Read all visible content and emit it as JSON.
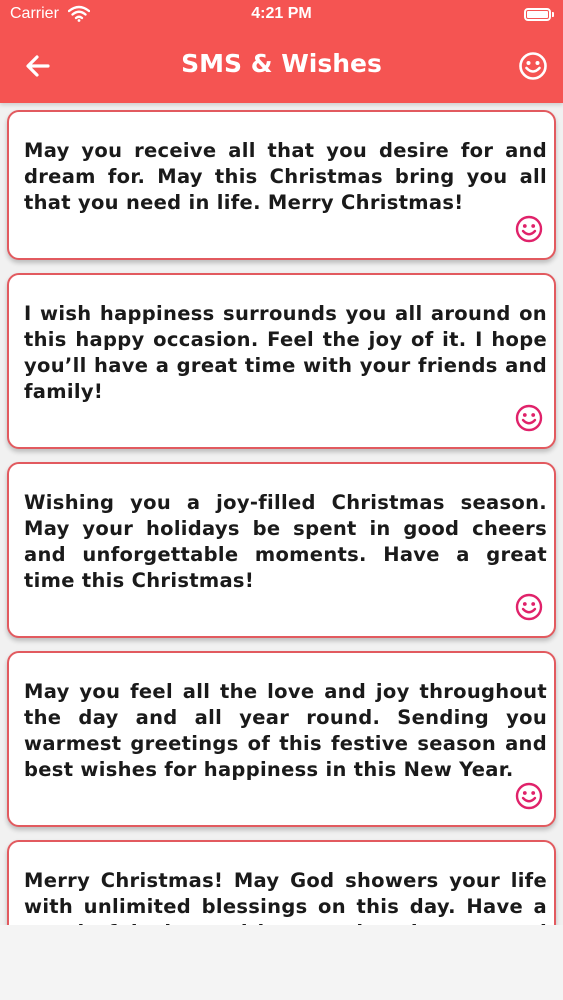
{
  "status_bar": {
    "carrier": "Carrier",
    "time": "4:21 PM"
  },
  "header": {
    "title": "SMS & Wishes",
    "back_icon": "arrow-left-icon",
    "right_icon": "smiley-icon"
  },
  "colors": {
    "header_bg": "#f55452",
    "card_border": "#e25a5f",
    "icon": "#e0226a"
  },
  "cards": [
    {
      "text": "May you receive all that you desire for and dream for. May this Christmas bring you all that you need in life. Merry Christmas!",
      "icon": "smiley-icon"
    },
    {
      "text": "I wish happiness surrounds you all around on this happy occasion. Feel the joy of it. I hope you’ll have a great time with your friends and family!",
      "icon": "smiley-icon"
    },
    {
      "text": "Wishing you a joy-filled Christmas season. May your holidays be spent in good cheers and unforgettable moments. Have a great time this Christmas!",
      "icon": "smiley-icon"
    },
    {
      "text": "May you feel all the love and joy throughout the day and all year round. Sending you warmest greetings of this festive season and best wishes for happiness in this New Year.",
      "icon": "smiley-icon"
    },
    {
      "text": "Merry Christmas! May God showers your life with unlimited blessings on this day. Have a wonderful time with your loved ones and friends.",
      "icon": "smiley-icon"
    }
  ]
}
